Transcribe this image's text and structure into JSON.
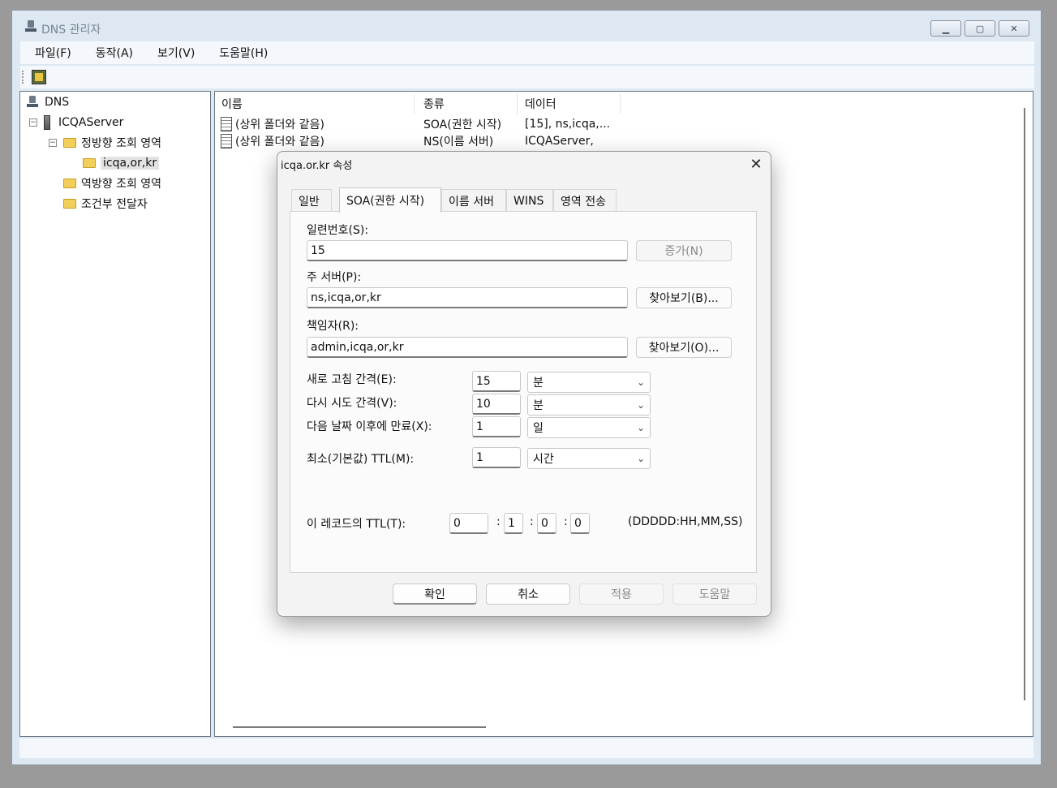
{
  "window": {
    "title": "DNS 관리자"
  },
  "menu": [
    "파일(F)",
    "동작(A)",
    "보기(V)",
    "도움말(H)"
  ],
  "tree": {
    "root": "DNS",
    "server": "ICQAServer",
    "forward_zones": "정방향 조회 영역",
    "zone": "icqa,or,kr",
    "reverse_zones": "역방향 조회 영역",
    "conditional": "조건부 전달자"
  },
  "list": {
    "columns": [
      "이름",
      "종류",
      "데이터"
    ],
    "rows": [
      {
        "name": "(상위 폴더와 같음)",
        "type": "SOA(권한 시작)",
        "data": "[15], ns,icqa,..."
      },
      {
        "name": "(상위 폴더와 같음)",
        "type": "NS(이름 서버)",
        "data": "ICQAServer,"
      }
    ]
  },
  "dialog": {
    "title": "icqa.or.kr 속성",
    "close": "✕",
    "tabs": [
      "일반",
      "SOA(권한 시작)",
      "이름 서버",
      "WINS",
      "영역 전송"
    ],
    "serial_label": "일련번호(S):",
    "serial_value": "15",
    "increment_button": "증가(N)",
    "primary_label": "주 서버(P):",
    "primary_value": "ns,icqa,or,kr",
    "browse_primary": "찾아보기(B)...",
    "responsible_label": "책임자(R):",
    "responsible_value": "admin,icqa,or,kr",
    "browse_responsible": "찾아보기(O)...",
    "refresh_label": "새로 고침 간격(E):",
    "refresh_value": "15",
    "refresh_unit": "분",
    "retry_label": "다시 시도 간격(V):",
    "retry_value": "10",
    "retry_unit": "분",
    "expire_label": "다음 날짜 이후에 만료(X):",
    "expire_value": "1",
    "expire_unit": "일",
    "minttl_label": "최소(기본값) TTL(M):",
    "minttl_value": "1",
    "minttl_unit": "시간",
    "ttl_label": "이 레코드의 TTL(T):",
    "ttl_days": "0",
    "ttl_hours": "1",
    "ttl_minutes": "0",
    "ttl_seconds": "0",
    "ttl_format": "(DDDDD:HH,MM,SS)",
    "ok": "확인",
    "cancel": "취소",
    "apply": "적용",
    "help": "도움말"
  }
}
